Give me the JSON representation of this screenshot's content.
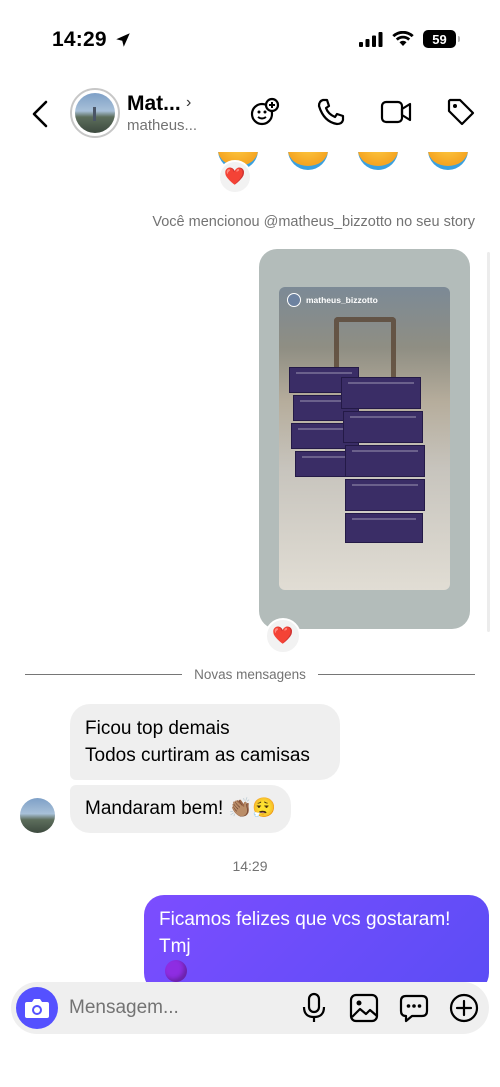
{
  "status_bar": {
    "time": "14:29",
    "battery": "59"
  },
  "header": {
    "contact_name": "Mat...",
    "contact_username": "matheus..."
  },
  "chat": {
    "mention_note": "Você mencionou @matheus_bizzotto no seu story",
    "story": {
      "username": "matheus_bizzotto"
    },
    "divider_label": "Novas mensagens",
    "incoming": [
      {
        "lines": [
          "Ficou top demais",
          "Todos curtiram as camisas"
        ]
      },
      {
        "text": "Mandaram bem! 👏🏽😮‍💨"
      }
    ],
    "timestamp": "14:29",
    "outgoing": {
      "line1": "Ficamos felizes que vcs gostaram!",
      "line2": "Tmj"
    },
    "reaction_emoji": "❤️"
  },
  "composer": {
    "placeholder": "Mensagem..."
  },
  "colors": {
    "accent": "#5551ff",
    "outgoing_bubble": "#6f45ff",
    "incoming_bubble": "#efefef",
    "secondary_text": "#737373"
  }
}
